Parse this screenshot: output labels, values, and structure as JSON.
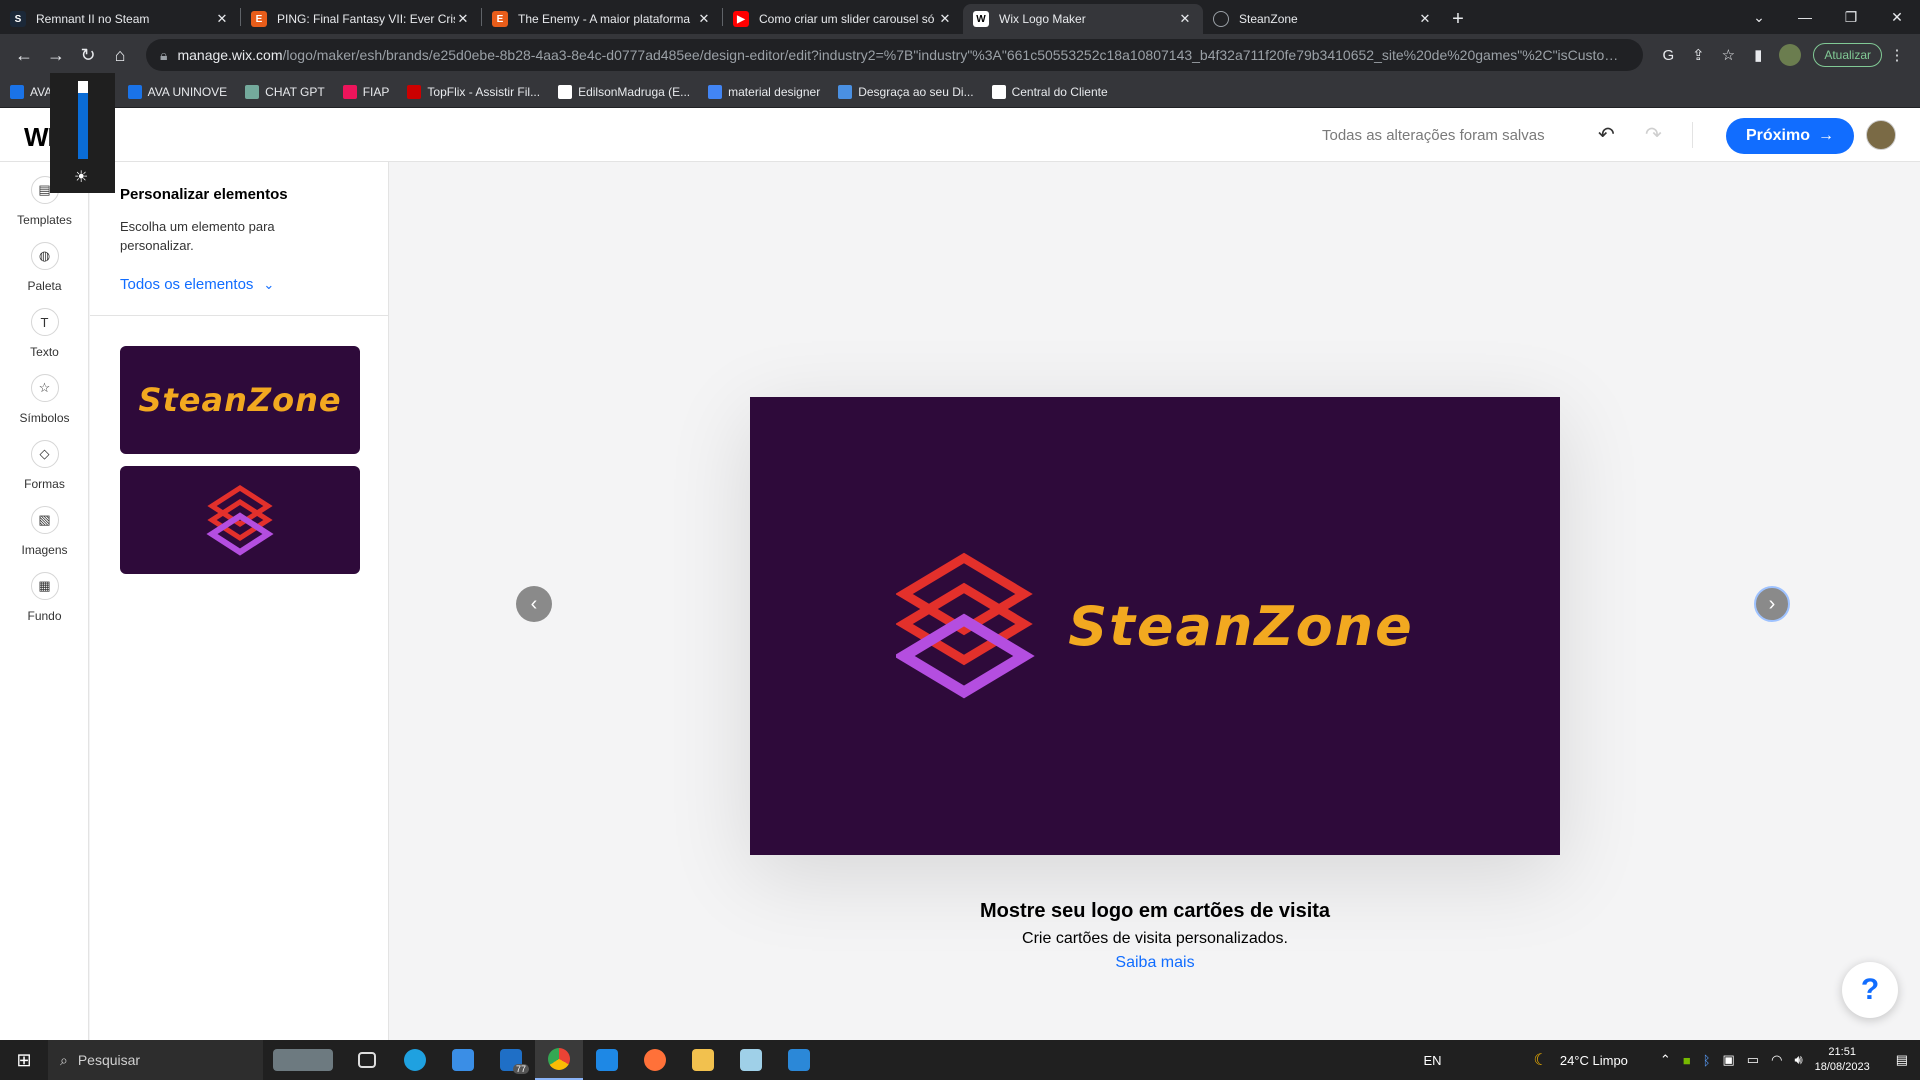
{
  "browser": {
    "tabs": [
      {
        "title": "Remnant II no Steam",
        "color": "#1b2838",
        "active": false
      },
      {
        "title": "PING: Final Fantasy VII: Ever Crisis",
        "color": "#e85d1a",
        "active": false
      },
      {
        "title": "The Enemy - A maior plataforma",
        "color": "#e85d1a",
        "active": false
      },
      {
        "title": "Como criar um slider carousel só",
        "color": "#ff0000",
        "active": false
      },
      {
        "title": "Wix Logo Maker",
        "color": "#ffffff",
        "active": true
      },
      {
        "title": "SteanZone",
        "color": "#9aa0a6",
        "active": false
      }
    ],
    "url_host": "manage.wix.com",
    "url_path": "/logo/maker/esh/brands/e25d0ebe-8b28-4aa3-8e4c-d0777ad485ee/design-editor/edit?industry2=%7B\"industry\"%3A\"661c50553252c18a10807143_b4f32a711f20fe79b3410652_site%20de%20games\"%2C\"isCustom\"%3Af...",
    "update_label": "Atualizar",
    "bookmarks": [
      {
        "label": "AVA UNINOVE",
        "color": "#1a73e8"
      },
      {
        "label": "AVA UNINOVE",
        "color": "#1a73e8"
      },
      {
        "label": "CHAT GPT",
        "color": "#74aa9c"
      },
      {
        "label": "FIAP",
        "color": "#ed145b"
      },
      {
        "label": "TopFlix - Assistir Fil...",
        "color": "#c00"
      },
      {
        "label": "EdilsonMadruga (E...",
        "color": "#ffffff"
      },
      {
        "label": "material designer",
        "color": "#4285f4"
      },
      {
        "label": "Desgraça ao seu Di...",
        "color": "#4a90e2"
      },
      {
        "label": "Central do Cliente",
        "color": "#ffffff"
      }
    ]
  },
  "header": {
    "logo": "WIX",
    "saved_status": "Todas as alterações foram salvas",
    "next_label": "Próximo"
  },
  "sidebar": {
    "items": [
      {
        "label": "Templates",
        "icon": "templates-icon",
        "glyph": "▤"
      },
      {
        "label": "Paleta",
        "icon": "palette-icon",
        "glyph": "◍"
      },
      {
        "label": "Texto",
        "icon": "text-icon",
        "glyph": "T"
      },
      {
        "label": "Símbolos",
        "icon": "star-icon",
        "glyph": "☆"
      },
      {
        "label": "Formas",
        "icon": "shapes-icon",
        "glyph": "◇"
      },
      {
        "label": "Imagens",
        "icon": "image-icon",
        "glyph": "▧"
      },
      {
        "label": "Fundo",
        "icon": "background-icon",
        "glyph": "▦"
      }
    ]
  },
  "panel": {
    "title": "Personalizar elementos",
    "description": "Escolha um elemento para personalizar.",
    "filter": "Todos os elementos",
    "cards": [
      {
        "type": "text",
        "text": "SteanZone"
      },
      {
        "type": "symbol"
      }
    ]
  },
  "canvas": {
    "brand_name": "SteanZone",
    "caption_title": "Mostre seu logo em cartões de visita",
    "caption_subtitle": "Crie cartões de visita personalizados.",
    "caption_link": "Saiba mais"
  },
  "taskbar": {
    "search_placeholder": "Pesquisar",
    "lang": "EN",
    "weather": "24°C  Limpo",
    "time": "21:51",
    "date": "18/08/2023",
    "mail_badge": "77"
  },
  "colors": {
    "accent": "#116dff",
    "card_bg": "#2e0a3a",
    "brand_gold": "#f2a920"
  }
}
